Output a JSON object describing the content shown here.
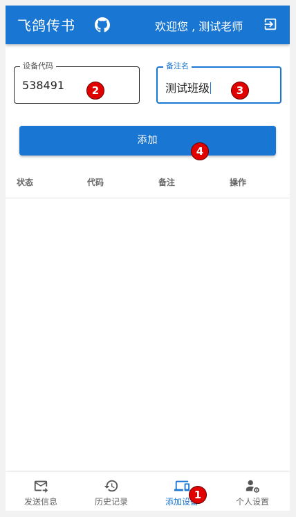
{
  "appbar": {
    "title": "飞鸽传书",
    "welcome": "欢迎您 , 测试老师"
  },
  "form": {
    "device_code": {
      "label": "设备代码",
      "value": "538491"
    },
    "remark": {
      "label": "备注名",
      "value": "测试班级"
    },
    "add_button": "添加"
  },
  "table": {
    "headers": [
      "状态",
      "代码",
      "备注",
      "操作"
    ],
    "rows": []
  },
  "bottom_nav": {
    "items": [
      {
        "label": "发送信息",
        "icon": "send-mail-icon"
      },
      {
        "label": "历史记录",
        "icon": "history-icon"
      },
      {
        "label": "添加设备",
        "icon": "devices-icon"
      },
      {
        "label": "个人设置",
        "icon": "person-settings-icon"
      }
    ],
    "active_index": 2
  },
  "markers": [
    "1",
    "2",
    "3",
    "4"
  ],
  "colors": {
    "primary": "#1976d2",
    "marker": "#e00000"
  }
}
